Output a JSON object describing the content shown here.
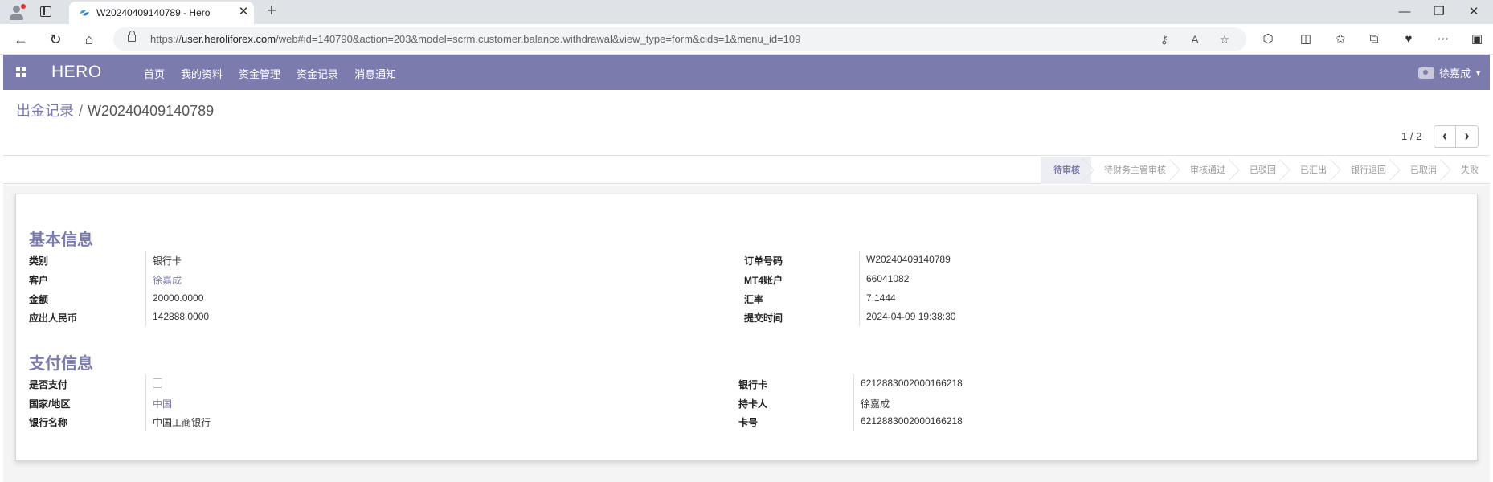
{
  "browser": {
    "tab_title": "W20240409140789 - Hero",
    "url_prefix": "https://",
    "url_host": "user.heroliforex.com",
    "url_rest": "/web#id=140790&action=203&model=scrm.customer.balance.withdrawal&view_type=form&cids=1&menu_id=109"
  },
  "navbar": {
    "brand": "HERO",
    "menu": [
      "首页",
      "我的资料",
      "资金管理",
      "资金记录",
      "消息通知"
    ],
    "user_name": "徐嘉成"
  },
  "breadcrumb": {
    "parent": "出金记录",
    "separator": "/",
    "current": "W20240409140789"
  },
  "pager": {
    "value": "1 / 2"
  },
  "stages": [
    "待审核",
    "待财务主管审核",
    "审核通过",
    "已驳回",
    "已汇出",
    "银行退回",
    "已取消",
    "失败"
  ],
  "active_stage": "待审核",
  "basic_info": {
    "title": "基本信息",
    "left": [
      {
        "label": "类别",
        "value": "银行卡"
      },
      {
        "label": "客户",
        "value": "徐嘉成"
      },
      {
        "label": "金额",
        "value": "20000.0000"
      },
      {
        "label": "应出人民币",
        "value": "142888.0000"
      }
    ],
    "right": [
      {
        "label": "订单号码",
        "value": "W20240409140789"
      },
      {
        "label": "MT4账户",
        "value": "66041082"
      },
      {
        "label": "汇率",
        "value": "7.1444"
      },
      {
        "label": "提交时间",
        "value": "2024-04-09 19:38:30"
      }
    ]
  },
  "payment_info": {
    "title": "支付信息",
    "left": [
      {
        "label": "是否支付",
        "value": ""
      },
      {
        "label": "国家/地区",
        "value": "中国"
      },
      {
        "label": "银行名称",
        "value": "中国工商银行"
      }
    ],
    "right": [
      {
        "label": "银行卡",
        "value": "6212883002000166218"
      },
      {
        "label": "持卡人",
        "value": "徐嘉成"
      },
      {
        "label": "卡号",
        "value": "6212883002000166218"
      }
    ]
  },
  "colors": {
    "accent": "#7c7bad",
    "tabbar": "#dfe3e8"
  },
  "icons": [
    "profile-icon",
    "tab-actions-icon",
    "favicon-icon",
    "back-arrow-icon",
    "reload-icon",
    "home-icon",
    "lock-icon",
    "key-icon",
    "read-aloud-icon",
    "favorite-star-icon",
    "extensions-icon",
    "split-screen-icon",
    "favorites-icon",
    "collections-icon",
    "performance-icon",
    "more-icon",
    "sidebar-icon",
    "apps-grid-icon",
    "camera-icon"
  ]
}
